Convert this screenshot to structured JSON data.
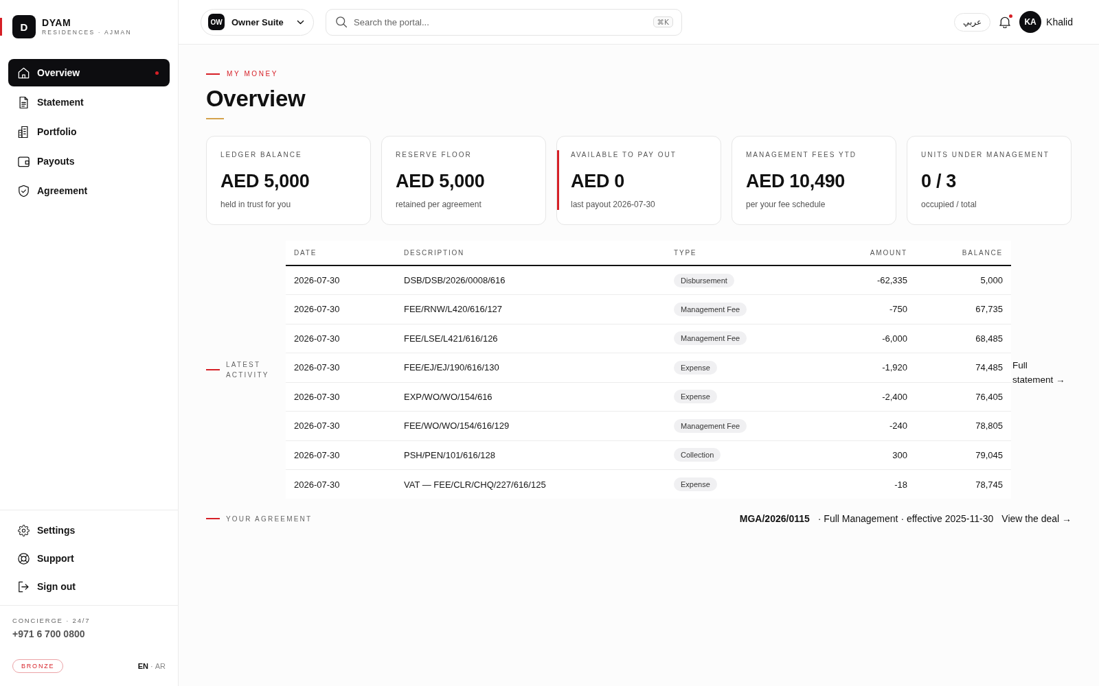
{
  "brand": {
    "logo": "D",
    "name": "DYAM",
    "tagline": "RESIDENCES · AJMAN"
  },
  "sidebar": {
    "items": [
      {
        "label": "Overview",
        "selected": true,
        "alert": true
      },
      {
        "label": "Statement",
        "selected": false,
        "alert": false
      },
      {
        "label": "Portfolio",
        "selected": false,
        "alert": false
      },
      {
        "label": "Payouts",
        "selected": false,
        "alert": false
      },
      {
        "label": "Agreement",
        "selected": false,
        "alert": false
      }
    ],
    "footer_items": [
      {
        "label": "Settings"
      },
      {
        "label": "Support"
      },
      {
        "label": "Sign out"
      }
    ],
    "concierge": {
      "label": "CONCIERGE · 24/7",
      "phone": "+971 6 700 0800"
    },
    "tier": "BRONZE",
    "languages": {
      "options": [
        {
          "label": "EN",
          "selected": true
        },
        {
          "label": "AR",
          "selected": false
        }
      ],
      "separator": "·"
    }
  },
  "topbar": {
    "suite": {
      "badge": "OW",
      "label": "Owner Suite"
    },
    "search": {
      "placeholder": "Search the portal...",
      "shortcut": "⌘K"
    },
    "language": "عربي",
    "notifications": {
      "unread": true
    },
    "user": {
      "initials": "KA",
      "name": "Khalid"
    }
  },
  "page": {
    "eyebrow": "MY MONEY",
    "title": "Overview"
  },
  "cards": [
    {
      "label": "LEDGER BALANCE",
      "value": "AED 5,000",
      "note": "held in trust for you",
      "highlighted": false
    },
    {
      "label": "RESERVE FLOOR",
      "value": "AED 5,000",
      "note": "retained per agreement",
      "highlighted": false
    },
    {
      "label": "AVAILABLE TO PAY OUT",
      "value": "AED 0",
      "note": "last payout 2026-07-30",
      "highlighted": true
    },
    {
      "label": "MANAGEMENT FEES YTD",
      "value": "AED 10,490",
      "note": "per your fee schedule",
      "highlighted": false
    },
    {
      "label": "UNITS UNDER MANAGEMENT",
      "value": "0 / 3",
      "note": "occupied / total",
      "highlighted": false
    }
  ],
  "activity": {
    "label": "LATEST ACTIVITY",
    "columns": [
      "DATE",
      "DESCRIPTION",
      "TYPE",
      "AMOUNT",
      "BALANCE"
    ],
    "rows": [
      {
        "date": "2026-07-30",
        "description": "DSB/DSB/2026/0008/616",
        "type": "Disbursement",
        "amount": "-62,335",
        "balance": "5,000"
      },
      {
        "date": "2026-07-30",
        "description": "FEE/RNW/L420/616/127",
        "type": "Management Fee",
        "amount": "-750",
        "balance": "67,735"
      },
      {
        "date": "2026-07-30",
        "description": "FEE/LSE/L421/616/126",
        "type": "Management Fee",
        "amount": "-6,000",
        "balance": "68,485"
      },
      {
        "date": "2026-07-30",
        "description": "FEE/EJ/EJ/190/616/130",
        "type": "Expense",
        "amount": "-1,920",
        "balance": "74,485"
      },
      {
        "date": "2026-07-30",
        "description": "EXP/WO/WO/154/616",
        "type": "Expense",
        "amount": "-2,400",
        "balance": "76,405"
      },
      {
        "date": "2026-07-30",
        "description": "FEE/WO/WO/154/616/129",
        "type": "Management Fee",
        "amount": "-240",
        "balance": "78,805"
      },
      {
        "date": "2026-07-30",
        "description": "PSH/PEN/101/616/128",
        "type": "Collection",
        "amount": "300",
        "balance": "79,045"
      },
      {
        "date": "2026-07-30",
        "description": "VAT — FEE/CLR/CHQ/227/616/125",
        "type": "Expense",
        "amount": "-18",
        "balance": "78,745"
      }
    ],
    "link": "Full statement →"
  },
  "agreement": {
    "label": "YOUR AGREEMENT",
    "reference": "MGA/2026/0115",
    "summary": "· Full Management · effective 2025-11-30",
    "link": "View the deal →"
  }
}
